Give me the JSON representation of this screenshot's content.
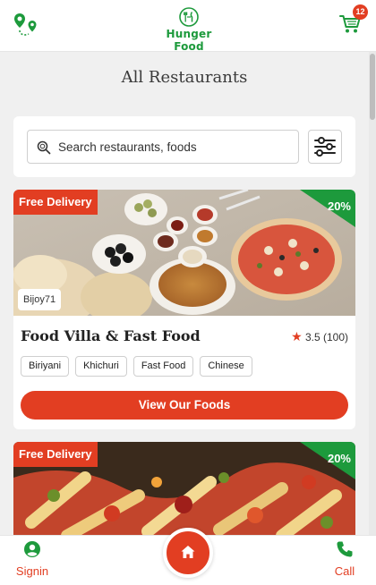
{
  "header": {
    "route_icon": "route-pin-icon",
    "logo_text": "Hunger Food",
    "cart_icon": "cart-icon",
    "cart_count": "12"
  },
  "page_title": "All Restaurants",
  "search": {
    "placeholder": "Search restaurants, foods",
    "value": "",
    "filter_icon": "sliders-icon"
  },
  "restaurants": [
    {
      "badge": "Free Delivery",
      "discount": "20%",
      "owner": "Bijoy71",
      "name": "Food Villa & Fast Food",
      "rating": "3.5 (100)",
      "tags": [
        "Biriyani",
        "Khichuri",
        "Fast Food",
        "Chinese"
      ],
      "button": "View Our Foods"
    },
    {
      "badge": "Free Delivery",
      "discount": "20%"
    }
  ],
  "bottom_nav": {
    "signin_label": "Signin",
    "home_icon": "home-icon",
    "call_label": "Call"
  },
  "colors": {
    "brand_green": "#1d9a3c",
    "accent_red": "#e23e22",
    "page_bg": "#f0f0f0"
  }
}
